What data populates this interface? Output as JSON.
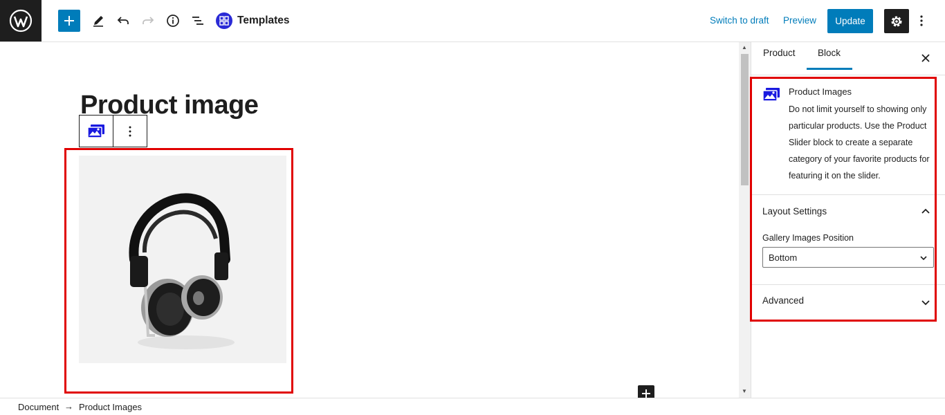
{
  "header": {
    "document_title": "Templates",
    "switch_to_draft": "Switch to draft",
    "preview": "Preview",
    "update": "Update",
    "icons": [
      "wordpress-icon",
      "plus-icon",
      "pencil-icon",
      "undo-icon",
      "redo-icon",
      "info-icon",
      "list-view-icon",
      "templates-icon",
      "gear-icon",
      "more-vertical-icon"
    ]
  },
  "editor": {
    "heading": "Product image",
    "block_toolbar": {
      "type_icon": "product-images-icon",
      "more_icon": "more-vertical-icon"
    },
    "image_alt": "headphones"
  },
  "sidebar": {
    "tabs": [
      {
        "label": "Product"
      },
      {
        "label": "Block"
      }
    ],
    "active_tab": "Block",
    "block": {
      "title": "Product Images",
      "description": "Do not limit yourself to showing only particular products. Use the Product Slider block to create a separate category of your favorite products for featuring it on the slider."
    },
    "layout": {
      "title": "Layout Settings",
      "expanded": true,
      "gallery_label": "Gallery Images Position",
      "gallery_value": "Bottom"
    },
    "advanced": {
      "title": "Advanced",
      "expanded": false
    }
  },
  "footer": {
    "crumb_document": "Document",
    "crumb_separator": "→",
    "crumb_block": "Product Images"
  },
  "colors": {
    "accent": "#007cba",
    "highlight": "#e00000",
    "dark": "#1e1e1e"
  }
}
